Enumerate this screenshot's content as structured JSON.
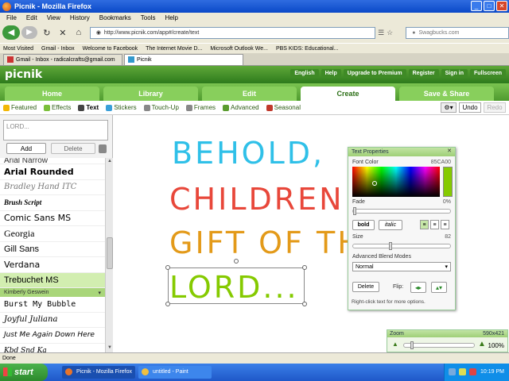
{
  "window": {
    "title": "Picnik - Mozilla Firefox"
  },
  "menu": [
    "File",
    "Edit",
    "View",
    "History",
    "Bookmarks",
    "Tools",
    "Help"
  ],
  "nav": {
    "url": "http://www.picnik.com/app#/create/text",
    "search_placeholder": "Swagbucks.com"
  },
  "bookmarks": [
    "Most Visited",
    "Gmail - Inbox",
    "Welcome to Facebook",
    "The Internet Movie D...",
    "Microsoft Outlook We...",
    "PBS KIDS: Educational..."
  ],
  "tabs": [
    {
      "label": "Gmail - Inbox - radicalcrafts@gmail.com",
      "active": false
    },
    {
      "label": "Picnik",
      "active": true
    }
  ],
  "picnik": {
    "logo": "picnik",
    "top_links": [
      "English",
      "Help",
      "Upgrade to Premium",
      "Register",
      "Sign in",
      "Fullscreen"
    ],
    "main_tabs": [
      {
        "label": "Home",
        "active": false
      },
      {
        "label": "Library",
        "active": false
      },
      {
        "label": "Edit",
        "active": false
      },
      {
        "label": "Create",
        "active": true
      },
      {
        "label": "Save & Share",
        "active": false
      }
    ],
    "sub_tabs": [
      {
        "label": "Featured",
        "icon": "star-icon",
        "color": "#f2b705"
      },
      {
        "label": "Effects",
        "icon": "effects-icon",
        "color": "#7bbf3a"
      },
      {
        "label": "Text",
        "icon": "text-icon",
        "color": "#444444",
        "active": true
      },
      {
        "label": "Stickers",
        "icon": "sticker-icon",
        "color": "#3a9fd8"
      },
      {
        "label": "Touch-Up",
        "icon": "touchup-icon",
        "color": "#888888"
      },
      {
        "label": "Frames",
        "icon": "frames-icon",
        "color": "#888888"
      },
      {
        "label": "Advanced",
        "icon": "advanced-icon",
        "color": "#5a9c2e"
      },
      {
        "label": "Seasonal",
        "icon": "seasonal-icon",
        "color": "#c0392b"
      }
    ],
    "undo": "Undo",
    "redo": "Redo"
  },
  "left": {
    "text_value": "LORD...",
    "add": "Add",
    "delete": "Delete",
    "fonts": [
      {
        "name": "Arial Narrow"
      },
      {
        "name": "Arial Rounded"
      },
      {
        "name": "Bradley Hand ITC"
      },
      {
        "name": "Brush Script"
      },
      {
        "name": "Comic Sans MS"
      },
      {
        "name": "Georgia"
      },
      {
        "name": "Gill Sans"
      },
      {
        "name": "Verdana"
      },
      {
        "name": "Trebuchet MS",
        "selected": true
      },
      {
        "name": "Kimberly Geswein",
        "group": true
      },
      {
        "name": "Burst My Bubble"
      },
      {
        "name": "Joyful Juliana"
      },
      {
        "name": "Just Me Again Down Here"
      },
      {
        "name": "Kbd Snd Ka"
      }
    ]
  },
  "canvas": {
    "lines": [
      {
        "text": "BEHOLD,",
        "color": "#2fc0e8"
      },
      {
        "text": "CHILDREN A",
        "color": "#e8473a"
      },
      {
        "text": "GIFT OF TH",
        "color": "#e39a19"
      },
      {
        "text": "LORD...",
        "color": "#85ca00"
      }
    ]
  },
  "props": {
    "title": "Text Properties",
    "font_color_label": "Font Color",
    "font_color_value": "85CA00",
    "fade_label": "Fade",
    "fade_value": "0%",
    "fade_level": 0,
    "bold": "bold",
    "italic": "italic",
    "size_label": "Size",
    "size_value": "82",
    "blend_label": "Advanced Blend Modes",
    "blend_value": "Normal",
    "delete": "Delete",
    "flip_label": "Flip:",
    "hint": "Right-click text for more options."
  },
  "zoom": {
    "label": "Zoom",
    "dims": "590x421",
    "percent": "100%"
  },
  "status": "Done",
  "taskbar": {
    "start": "start",
    "tasks": [
      "Picnik - Mozilla Firefox",
      "untitled - Paint"
    ],
    "time": "10:19 PM"
  }
}
